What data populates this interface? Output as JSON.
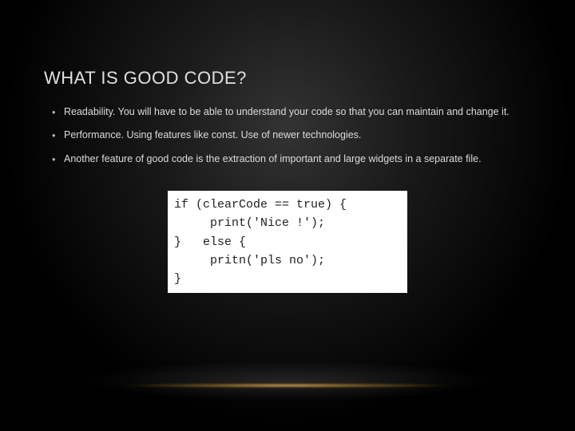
{
  "title": "WHAT IS GOOD CODE?",
  "bullets": [
    "Readability. You will have to be able to understand your code so that you can maintain and change it.",
    "Performance. Using features like const. Use of newer technologies.",
    "Another feature of good code is the extraction of important and large widgets in a separate file."
  ],
  "code_lines": [
    "if (clearCode == true) {",
    "     print('Nice !');",
    "}   else {",
    "     pritn('pls no');",
    "}"
  ]
}
